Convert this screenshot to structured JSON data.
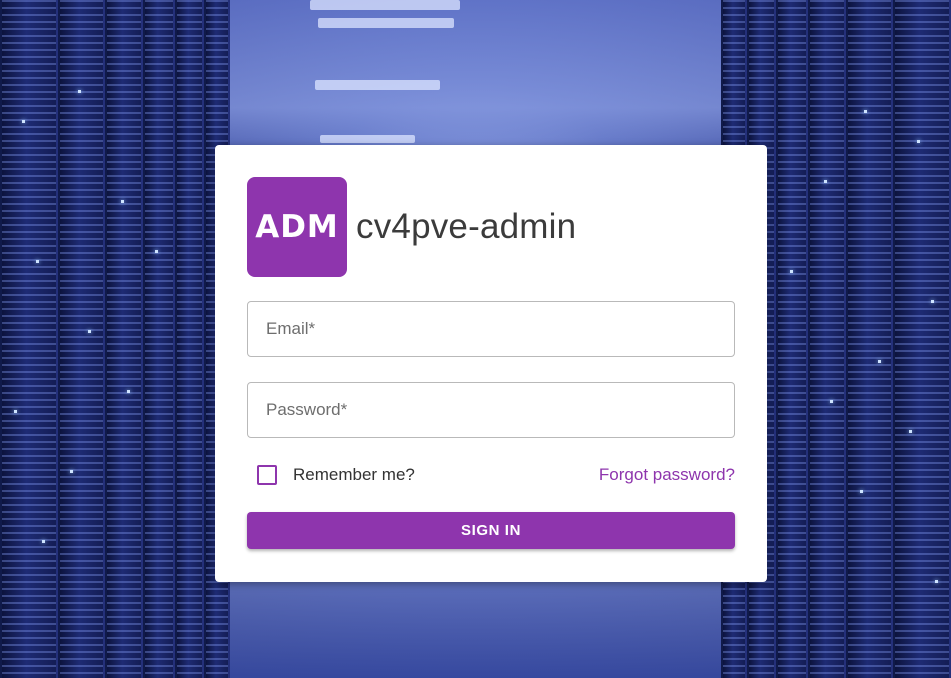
{
  "app": {
    "logo_text": "ADM",
    "title": "cv4pve-admin"
  },
  "form": {
    "email_placeholder": "Email*",
    "email_value": "",
    "password_placeholder": "Password*",
    "password_value": "",
    "remember_label": "Remember me?",
    "remember_checked": false,
    "forgot_label": "Forgot password?",
    "submit_label": "SIGN IN"
  },
  "colors": {
    "accent": "#8e35ad",
    "card_background": "#ffffff",
    "text_primary": "#3b3b3b"
  },
  "background": {
    "description_icon": "server-room-background"
  }
}
